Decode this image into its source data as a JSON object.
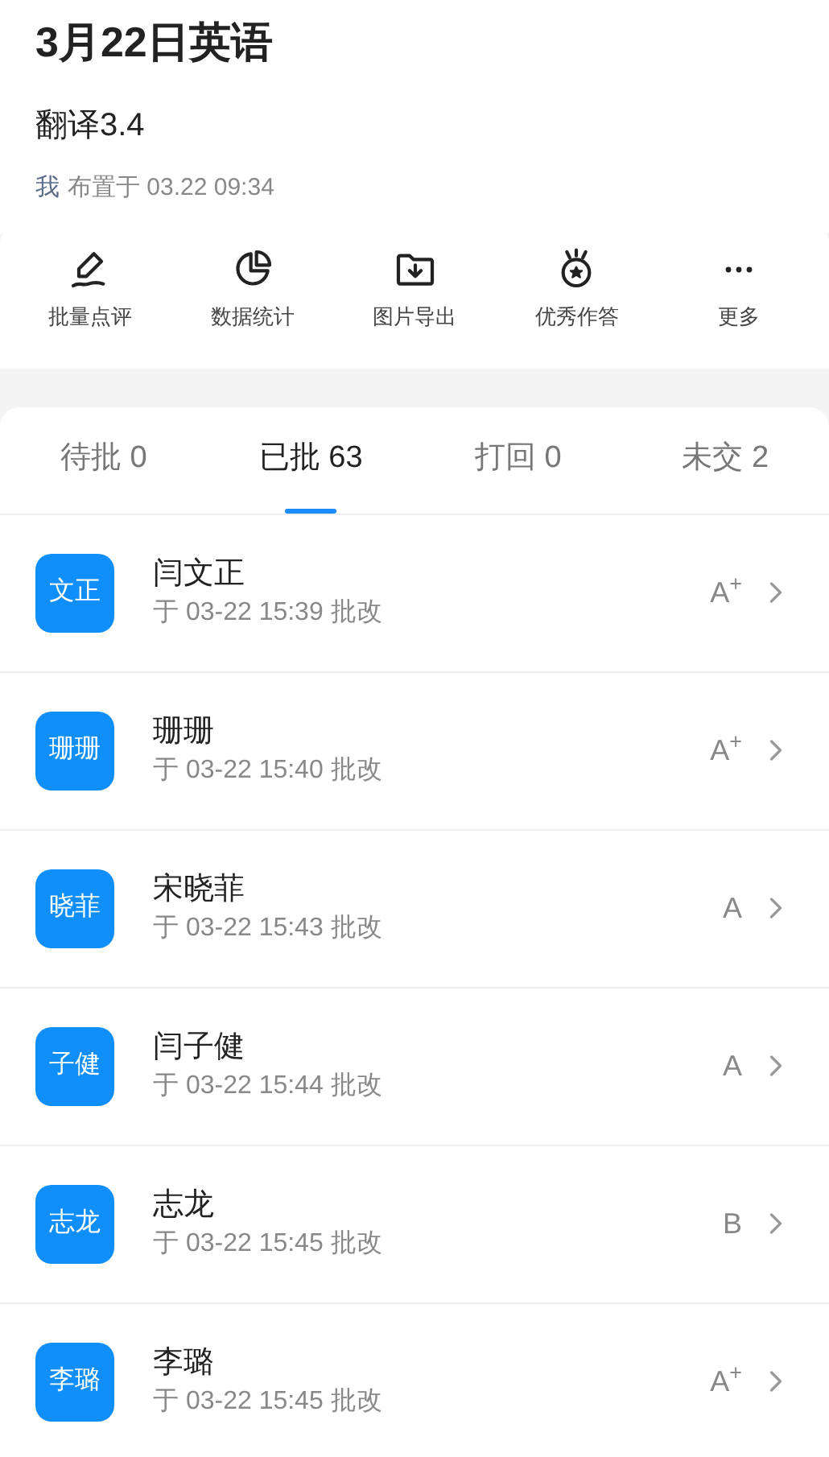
{
  "header": {
    "title": "3月22日英语",
    "subtitle": "翻译3.4",
    "author": "我",
    "meta": "布置于 03.22 09:34"
  },
  "actions": [
    {
      "kind": "review",
      "label": "批量点评"
    },
    {
      "kind": "stats",
      "label": "数据统计"
    },
    {
      "kind": "export",
      "label": "图片导出"
    },
    {
      "kind": "best",
      "label": "优秀作答"
    },
    {
      "kind": "more",
      "label": "更多"
    }
  ],
  "tabs": [
    {
      "label": "待批 0",
      "selected": false
    },
    {
      "label": "已批 63",
      "selected": true
    },
    {
      "label": "打回 0",
      "selected": false
    },
    {
      "label": "未交 2",
      "selected": false
    }
  ],
  "students": [
    {
      "avatar": "文正",
      "name": "闫文正",
      "time": "于 03-22 15:39 批改",
      "grade": "A$^{+}$"
    },
    {
      "avatar": "珊珊",
      "name": "珊珊",
      "time": "于 03-22 15:40 批改",
      "grade": "A$^{+}$"
    },
    {
      "avatar": "晓菲",
      "name": "宋晓菲",
      "time": "于 03-22 15:43 批改",
      "grade": "A"
    },
    {
      "avatar": "子健",
      "name": "闫子健",
      "time": "于 03-22 15:44 批改",
      "grade": "A"
    },
    {
      "avatar": "志龙",
      "name": "志龙",
      "time": "于 03-22 15:45 批改",
      "grade": "B"
    },
    {
      "avatar": "李璐",
      "name": "李璐",
      "time": "于 03-22 15:45 批改",
      "grade": "A$^{+}$"
    }
  ]
}
